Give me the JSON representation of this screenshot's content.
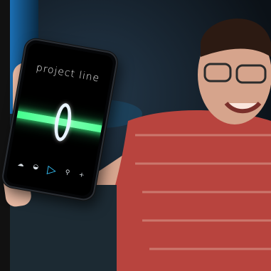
{
  "app": {
    "title": "project line"
  },
  "controls": [
    {
      "icon": "cloud-icon",
      "glyph": "☁"
    },
    {
      "icon": "disc-icon",
      "glyph": "◒"
    },
    {
      "icon": "play-icon",
      "glyph": "▷"
    },
    {
      "icon": "pin-icon",
      "glyph": "⚲"
    },
    {
      "icon": "plus-icon",
      "glyph": "+"
    }
  ],
  "colors": {
    "beam": "#3dff8a",
    "play": "#38c7ff",
    "sweater": "#b8443e",
    "background": "#0c1218"
  }
}
